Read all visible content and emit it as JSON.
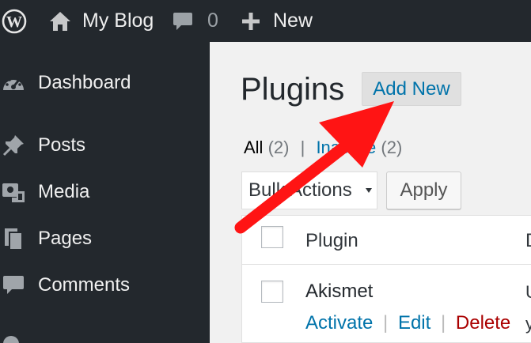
{
  "admin_bar": {
    "wp_logo_icon": "wordpress-logo-icon",
    "site_name": "My Blog",
    "site_icon": "home-icon",
    "comments_icon": "comment-bubble-icon",
    "comments_count": "0",
    "new_icon": "plus-icon",
    "new_label": "New"
  },
  "sidebar": {
    "items": [
      {
        "label": "Dashboard",
        "icon": "dashboard-gauge-icon"
      },
      {
        "label": "Posts",
        "icon": "pushpin-icon"
      },
      {
        "label": "Media",
        "icon": "media-camera-icon"
      },
      {
        "label": "Pages",
        "icon": "pages-icon"
      },
      {
        "label": "Comments",
        "icon": "comment-bubble-icon"
      }
    ]
  },
  "page": {
    "title": "Plugins",
    "add_new_label": "Add New",
    "filters": {
      "all_label": "All",
      "all_count": "(2)",
      "separator": "|",
      "inactive_label": "Inactive",
      "inactive_count": "(2)"
    },
    "bulk_actions": {
      "selected": "Bulk Actions"
    },
    "apply_label": "Apply",
    "table": {
      "columns": [
        "Plugin",
        "D"
      ],
      "rows": [
        {
          "name": "Akismet",
          "actions": [
            "Activate",
            "Edit",
            "Delete"
          ],
          "description_fragments": [
            "U",
            "y"
          ]
        }
      ]
    }
  },
  "annotation": {
    "type": "red-arrow",
    "points_to": "Add New",
    "color": "#ff0000"
  },
  "colors": {
    "admin_bar_bg": "#23282d",
    "sidebar_bg": "#23282d",
    "content_bg": "#f1f1f1",
    "link": "#0073aa",
    "delete": "#aa0000"
  }
}
